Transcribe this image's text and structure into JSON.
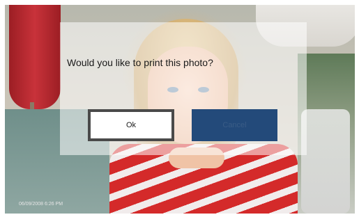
{
  "dialog": {
    "message": "Would you like to print this photo?",
    "ok_label": "Ok",
    "cancel_label": "Cancel"
  },
  "photo": {
    "timestamp": "06/09/2008 6:26 PM"
  },
  "colors": {
    "ok_button_border": "#4a4a4a",
    "cancel_button": "#234a7a",
    "dialog_overlay": "#ffffff"
  }
}
